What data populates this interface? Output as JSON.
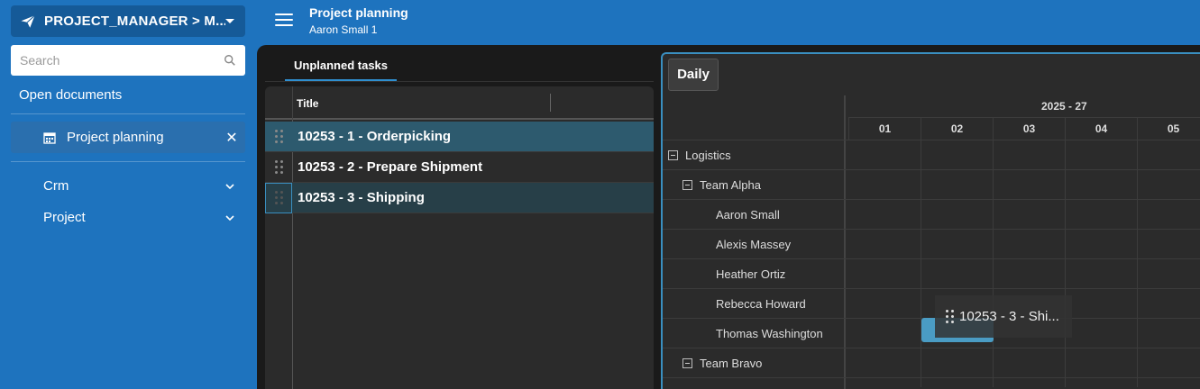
{
  "app": {
    "switcher_label": "PROJECT_MANAGER > M..."
  },
  "sidebar": {
    "search_placeholder": "Search",
    "open_documents_label": "Open documents",
    "open_doc": {
      "label": "Project planning"
    },
    "nav": [
      {
        "label": "Crm"
      },
      {
        "label": "Project"
      }
    ]
  },
  "header": {
    "title": "Project planning",
    "subtitle": "Aaron Small  1"
  },
  "tasks_panel": {
    "tab_label": "Unplanned tasks",
    "column_title": "Title",
    "rows": [
      {
        "title": "10253 - 1 - Orderpicking"
      },
      {
        "title": "10253 - 2 - Prepare Shipment"
      },
      {
        "title": "10253 - 3 - Shipping"
      }
    ]
  },
  "scheduler": {
    "view_button": "Daily",
    "week_label": "2025 - 27",
    "days": [
      "01",
      "02",
      "03",
      "04",
      "05"
    ],
    "resources": [
      {
        "name": "Logistics",
        "level": 0,
        "collapsible": true
      },
      {
        "name": "Team Alpha",
        "level": 1,
        "collapsible": true
      },
      {
        "name": "Aaron Small",
        "level": 2,
        "collapsible": false
      },
      {
        "name": "Alexis Massey",
        "level": 2,
        "collapsible": false
      },
      {
        "name": "Heather Ortiz",
        "level": 2,
        "collapsible": false
      },
      {
        "name": "Rebecca Howard",
        "level": 2,
        "collapsible": false
      },
      {
        "name": "Thomas Washington",
        "level": 2,
        "collapsible": false
      },
      {
        "name": "Team Bravo",
        "level": 1,
        "collapsible": true
      }
    ],
    "drag_tooltip": "10253 - 3 - Shi..."
  },
  "colors": {
    "accent": "#1e73be",
    "selected_row": "#2d5a6e",
    "event": "#4a9cc4"
  }
}
